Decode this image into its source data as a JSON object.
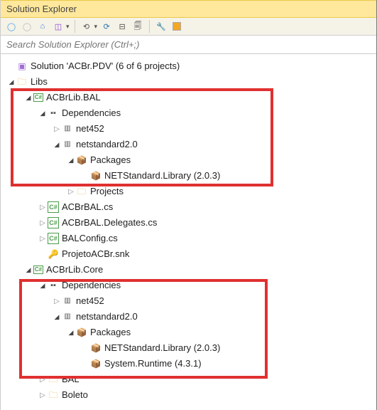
{
  "title": "Solution Explorer",
  "search_placeholder": "Search Solution Explorer (Ctrl+;)",
  "solution_label": "Solution 'ACBr.PDV' (6 of 6 projects)",
  "libs_label": "Libs",
  "proj_bal": {
    "name": "ACBrLib.BAL",
    "deps": "Dependencies",
    "net452": "net452",
    "netstd": "netstandard2.0",
    "packages": "Packages",
    "pkg_netstd": "NETStandard.Library (2.0.3)",
    "projects": "Projects",
    "cs1": "ACBrBAL.cs",
    "cs2": "ACBrBAL.Delegates.cs",
    "cs3": "BALConfig.cs",
    "snk": "ProjetoACBr.snk"
  },
  "proj_core": {
    "name": "ACBrLib.Core",
    "deps": "Dependencies",
    "net452": "net452",
    "netstd": "netstandard2.0",
    "packages": "Packages",
    "pkg_netstd": "NETStandard.Library (2.0.3)",
    "pkg_runtime": "System.Runtime (4.3.1)",
    "folder_bal": "BAL",
    "folder_boleto": "Boleto"
  }
}
